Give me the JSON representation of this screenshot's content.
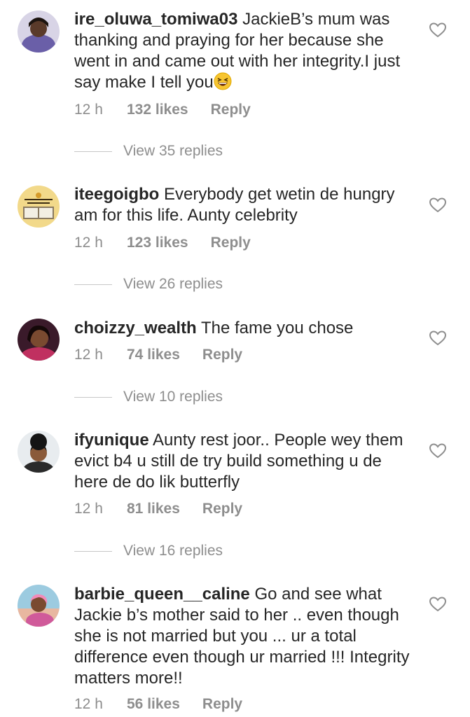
{
  "comments": [
    {
      "username": "ire_oluwa_tomiwa03",
      "text": "JackieB’s mum was thanking and praying for her because she went in and came out with her integrity.I just say make I tell you",
      "time": "12 h",
      "likes": "132 likes",
      "reply": "Reply",
      "view_replies": "View 35 replies",
      "avatar_icon": "user-photo-avatar"
    },
    {
      "username": "iteegoigbo",
      "text": "Everybody get wetin de hungry am for this life.  Aunty celebrity",
      "time": "12 h",
      "likes": "123 likes",
      "reply": "Reply",
      "view_replies": "View 26 replies",
      "avatar_icon": "bible-verse-avatar"
    },
    {
      "username": "choizzy_wealth",
      "text": "The fame you chose",
      "time": "12 h",
      "likes": "74 likes",
      "reply": "Reply",
      "view_replies": "View 10 replies",
      "avatar_icon": "user-photo-avatar"
    },
    {
      "username": "ifyunique",
      "text": "Aunty rest joor.. People wey them evict b4 u still de try build something u de here de do lik butterfly",
      "time": "12 h",
      "likes": "81 likes",
      "reply": "Reply",
      "view_replies": "View 16 replies",
      "avatar_icon": "user-photo-avatar"
    },
    {
      "username": "barbie_queen__caline",
      "text": "Go and see what Jackie b’s mother said to her .. even though she is not married but you ... ur a total difference even though ur married !!! Integrity matters more!!",
      "time": "12 h",
      "likes": "56 likes",
      "reply": "Reply",
      "avatar_icon": "user-photo-avatar"
    }
  ],
  "colors": {
    "text": "#262626",
    "secondary": "#8e8e8e",
    "divider": "#c7c7c7"
  },
  "icons": {
    "like": "heart-outline-icon",
    "emoji": "grinning-squinting-face-emoji"
  }
}
